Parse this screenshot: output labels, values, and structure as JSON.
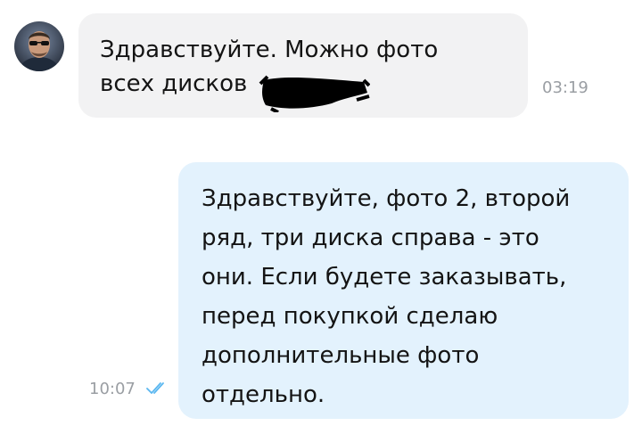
{
  "chat": {
    "messages": [
      {
        "direction": "incoming",
        "text": "Здравствуйте. Можно фото\nвсех дисков",
        "time": "03:19",
        "avatar_icon": "user-avatar-icon",
        "redacted": true
      },
      {
        "direction": "outgoing",
        "text": "Здравствуйте, фото 2, второй\nряд, три диска справа - это\nони. Если будете заказывать,\nперед покупкой сделаю\nдополнительные фото\nотдельно.",
        "time": "10:07",
        "status_icon": "double-check-icon",
        "status": "read"
      }
    ]
  },
  "colors": {
    "incoming_bubble": "#f2f2f3",
    "outgoing_bubble": "#e3f2fd",
    "timestamp": "#9a9ea3",
    "read_check": "#5ab7f0"
  }
}
